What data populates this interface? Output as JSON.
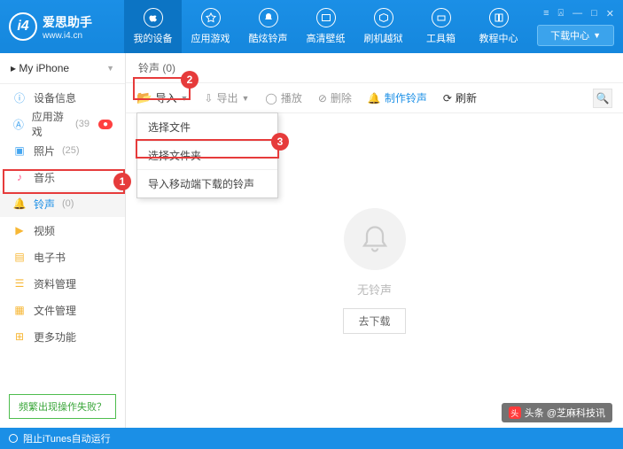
{
  "brand": {
    "name": "爱思助手",
    "url": "www.i4.cn",
    "logo_letter": "i4"
  },
  "nav": [
    {
      "label": "我的设备"
    },
    {
      "label": "应用游戏"
    },
    {
      "label": "酷炫铃声"
    },
    {
      "label": "高清壁纸"
    },
    {
      "label": "刷机越狱"
    },
    {
      "label": "工具箱"
    },
    {
      "label": "教程中心"
    }
  ],
  "download_center": "下载中心",
  "device": "My iPhone",
  "sidebar": [
    {
      "label": "设备信息",
      "icon": "info",
      "color": "#46a6f0"
    },
    {
      "label": "应用游戏",
      "icon": "app",
      "color": "#46a6f0",
      "count": "(39",
      "badge": true
    },
    {
      "label": "照片",
      "icon": "photo",
      "color": "#46a6f0",
      "count": "(25)"
    },
    {
      "label": "音乐",
      "icon": "music",
      "color": "#ff5a8c"
    },
    {
      "label": "铃声",
      "icon": "bell",
      "color": "#1b8fe6",
      "count": "(0)",
      "active": true
    },
    {
      "label": "视频",
      "icon": "video",
      "color": "#f7b735"
    },
    {
      "label": "电子书",
      "icon": "book",
      "color": "#f7b735"
    },
    {
      "label": "资料管理",
      "icon": "data",
      "color": "#f7b735"
    },
    {
      "label": "文件管理",
      "icon": "file",
      "color": "#f7b735"
    },
    {
      "label": "更多功能",
      "icon": "more",
      "color": "#f7b735"
    }
  ],
  "help_btn": "频繁出现操作失败？",
  "crumb": "铃声 (0)",
  "toolbar": {
    "import": "导入",
    "export": "导出",
    "play": "播放",
    "delete": "删除",
    "make": "制作铃声",
    "refresh": "刷新"
  },
  "dropdown": {
    "opt1": "选择文件",
    "opt2": "选择文件夹",
    "opt3": "导入移动端下载的铃声"
  },
  "empty": {
    "text": "无铃声",
    "btn": "去下载"
  },
  "footer": "阻止iTunes自动运行",
  "watermark": "头条 @芝麻科技讯",
  "callouts": {
    "c1": "1",
    "c2": "2",
    "c3": "3"
  }
}
